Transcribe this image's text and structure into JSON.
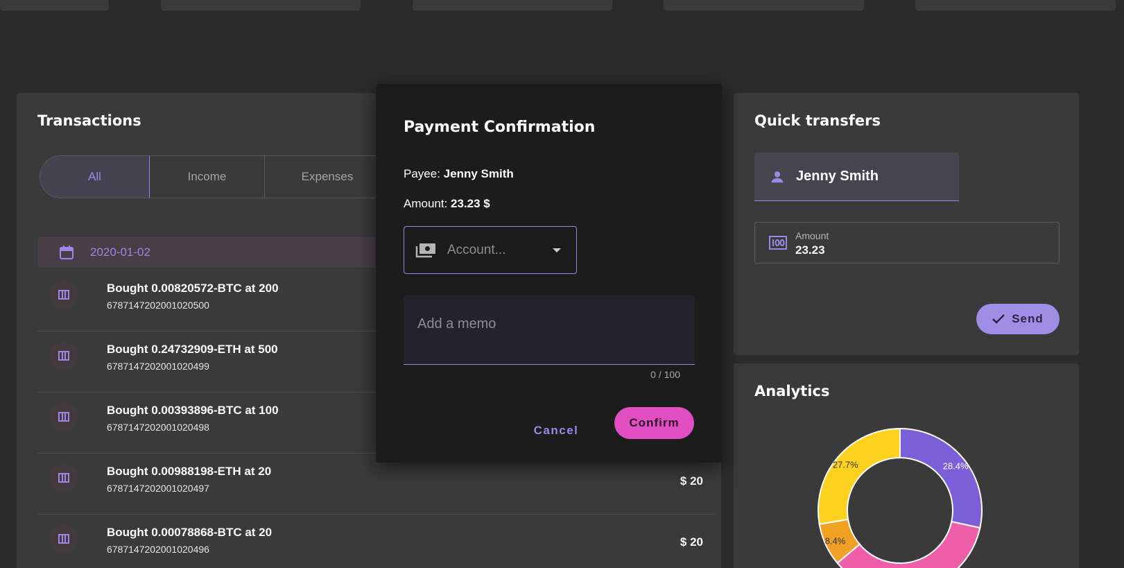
{
  "transactions": {
    "title": "Transactions",
    "tabs": [
      {
        "label": "All"
      },
      {
        "label": "Income"
      },
      {
        "label": "Expenses"
      }
    ],
    "date": "2020-01-02",
    "items": [
      {
        "title": "Bought 0.00820572-BTC at 200",
        "id": "6787147202001020500",
        "amount": ""
      },
      {
        "title": "Bought 0.24732909-ETH at 500",
        "id": "6787147202001020499",
        "amount": ""
      },
      {
        "title": "Bought 0.00393896-BTC at 100",
        "id": "6787147202001020498",
        "amount": ""
      },
      {
        "title": "Bought 0.00988198-ETH at 20",
        "id": "6787147202001020497",
        "amount": "$ 20"
      },
      {
        "title": "Bought 0.00078868-BTC at 20",
        "id": "6787147202001020496",
        "amount": "$ 20"
      }
    ]
  },
  "quick_transfers": {
    "title": "Quick transfers",
    "payee": "Jenny Smith",
    "amount_label": "Amount",
    "amount_value": "23.23",
    "send_label": "Send"
  },
  "analytics": {
    "title": "Analytics"
  },
  "chart_data": {
    "type": "pie",
    "donut": true,
    "slices": [
      {
        "label": "28.4%",
        "value": 28.4,
        "color": "#7b5fd9"
      },
      {
        "label": "",
        "value": 35.5,
        "color": "#ef5ea8"
      },
      {
        "label": "8.4%",
        "value": 8.4,
        "color": "#f0a022"
      },
      {
        "label": "27.7%",
        "value": 27.7,
        "color": "#fdd21f"
      }
    ]
  },
  "modal": {
    "title": "Payment Confirmation",
    "payee_prefix": "Payee:",
    "payee_value": "Jenny Smith",
    "amount_prefix": "Amount:",
    "amount_value": "23.23 $",
    "account_placeholder": "Account...",
    "memo_placeholder": "Add a memo",
    "memo_counter": "0 / 100",
    "cancel_label": "Cancel",
    "confirm_label": "Confirm"
  },
  "colors": {
    "accent": "#9b87e6",
    "confirm": "#e04ec2",
    "background": "#2b2b2b",
    "card": "#3a3a3a",
    "modal": "#1c1c1c"
  }
}
